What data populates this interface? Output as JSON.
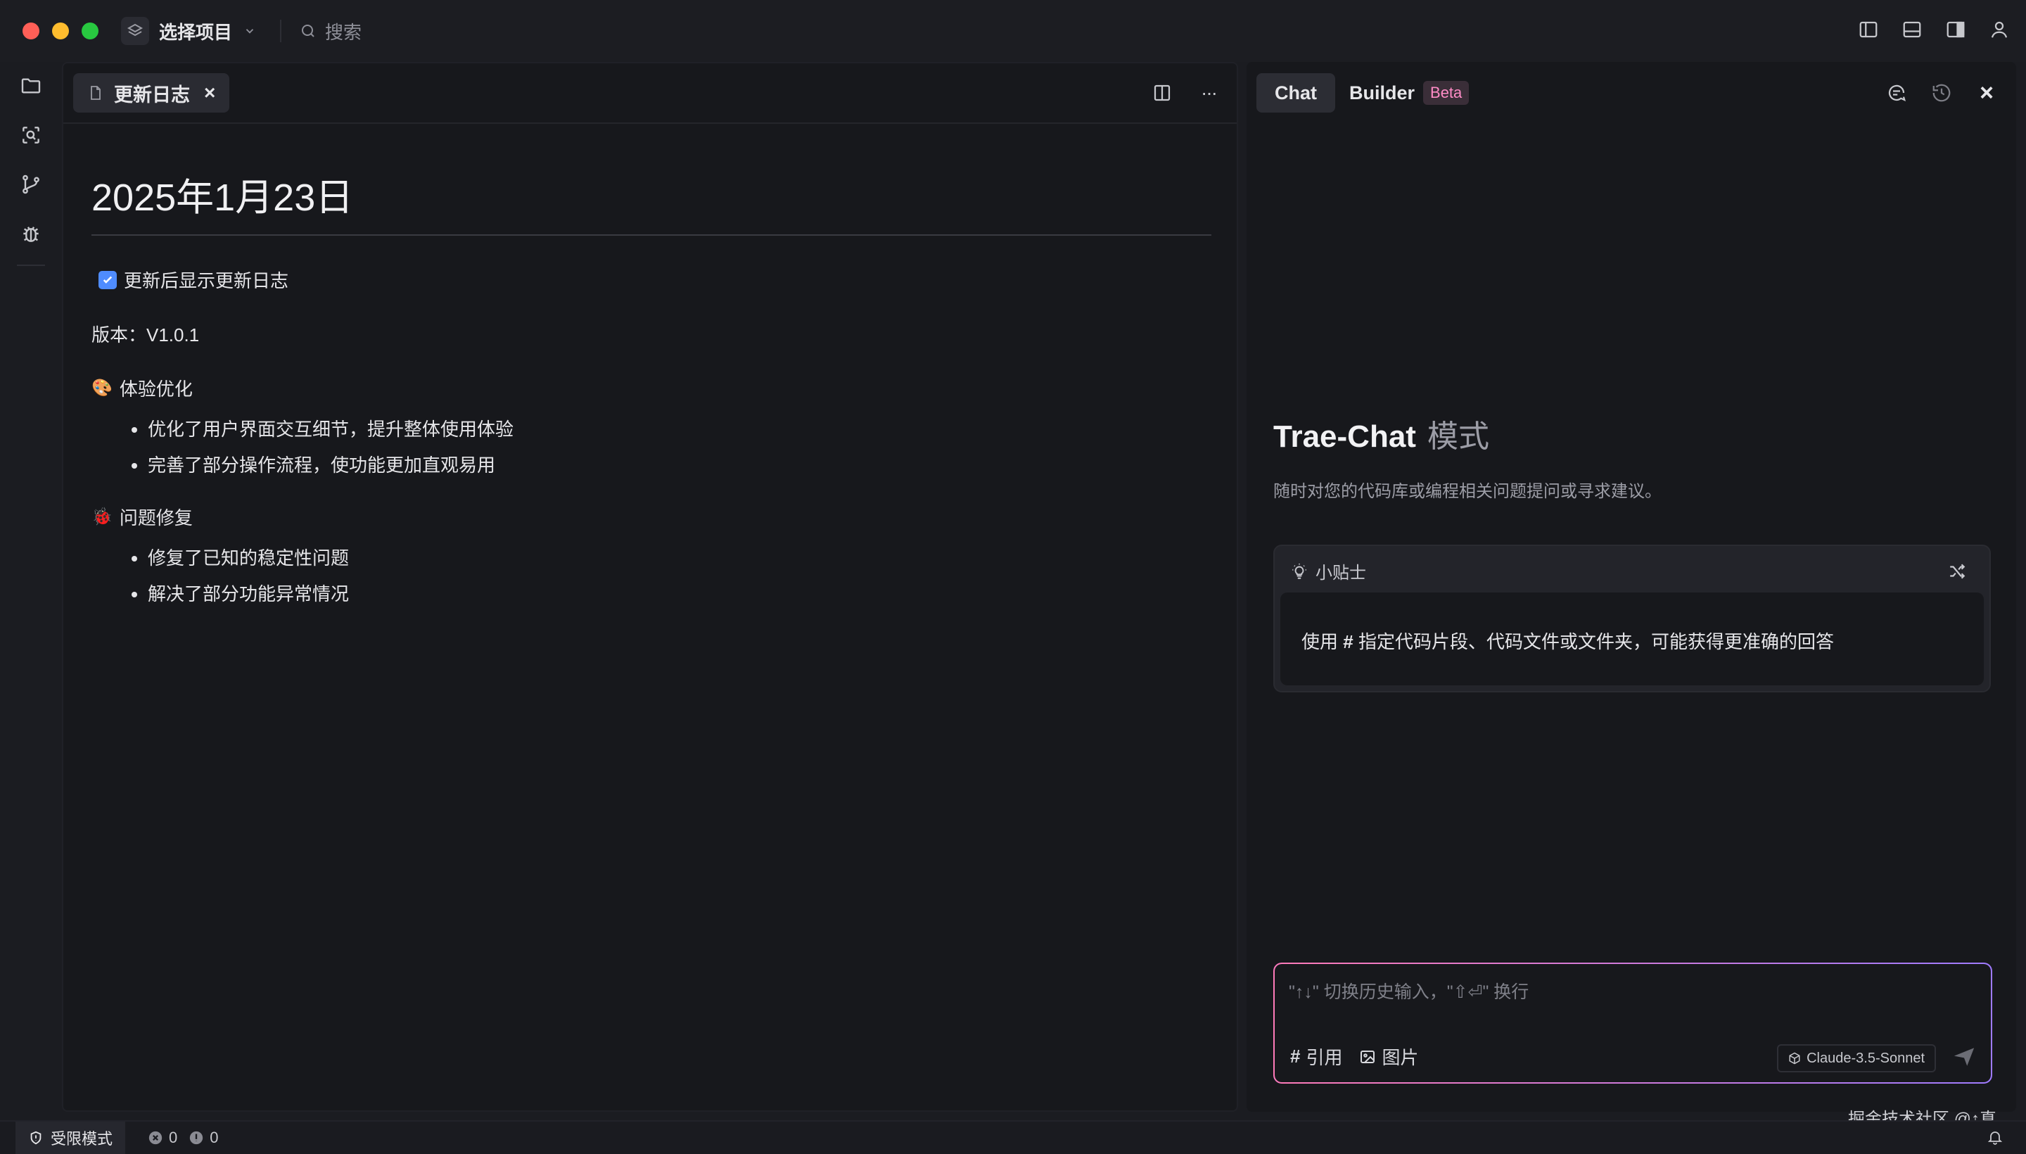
{
  "titlebar": {
    "project_label": "选择项目",
    "search_placeholder": "搜索"
  },
  "editor": {
    "tab_label": "更新日志",
    "tab_close": "×",
    "heading": "2025年1月23日",
    "checkbox_label": "更新后显示更新日志",
    "version": "版本：V1.0.1",
    "section1": {
      "emoji": "🎨",
      "title": "体验优化",
      "items": [
        "优化了用户界面交互细节，提升整体使用体验",
        "完善了部分操作流程，使功能更加直观易用"
      ]
    },
    "section2": {
      "emoji": "🐞",
      "title": "问题修复",
      "items": [
        "修复了已知的稳定性问题",
        "解决了部分功能异常情况"
      ]
    },
    "tab_more": "···"
  },
  "chat": {
    "tab_chat": "Chat",
    "tab_builder": "Builder",
    "beta": "Beta",
    "close": "×",
    "mode_title": "Trae-Chat",
    "mode_word": "模式",
    "mode_subtitle": "随时对您的代码库或编程相关问题提问或寻求建议。",
    "tip_title": "小贴士",
    "tip_text_before": "使用",
    "tip_hash": "#",
    "tip_text_after": "指定代码片段、代码文件或文件夹，可能获得更准确的回答",
    "input_placeholder": "\"↑↓\" 切换历史输入，\"⇧⏎\" 换行",
    "tool_ref_symbol": "#",
    "tool_ref": "引用",
    "tool_image": "图片",
    "model": "Claude-3.5-Sonnet"
  },
  "status": {
    "mode": "受限模式",
    "errors": "0",
    "warnings": "0"
  },
  "watermark": "掘金技术社区 @↑真"
}
